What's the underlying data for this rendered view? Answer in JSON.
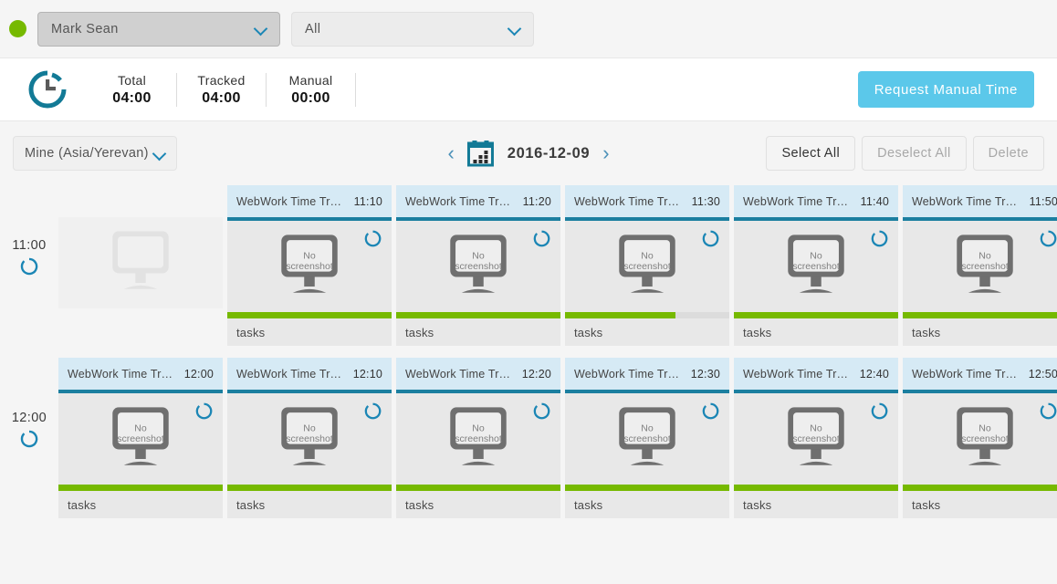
{
  "filterbar": {
    "status_dot_color": "#76b900",
    "user_select": {
      "value": "Mark  Sean",
      "icon": "chevron-down-icon"
    },
    "project_select": {
      "value": "All",
      "icon": "chevron-down-icon"
    }
  },
  "totals": {
    "icon": "clock-icon",
    "stats": [
      {
        "label": "Total",
        "value": "04:00"
      },
      {
        "label": "Tracked",
        "value": "04:00"
      },
      {
        "label": "Manual",
        "value": "00:00"
      }
    ],
    "request_button": {
      "label": "Request  Manual  Time",
      "color": "#5bc8ea"
    }
  },
  "toolbar": {
    "timezone": {
      "value": "Mine  (Asia/Yerevan)",
      "icon": "chevron-down-icon"
    },
    "date_nav": {
      "prev_icon": "chevron-left-icon",
      "calendar_icon": "calendar-icon",
      "date": "2016-12-09",
      "next_icon": "chevron-right-icon"
    },
    "buttons": [
      {
        "label": "Select  All",
        "state": "active"
      },
      {
        "label": "Deselect  All",
        "state": "disabled"
      },
      {
        "label": "Delete",
        "state": "disabled"
      }
    ]
  },
  "grid": {
    "placeholder_label": "No screenshot",
    "rows": [
      {
        "time": "11:00",
        "spinner_icon": "loading-ring-icon",
        "cells": [
          {
            "type": "empty"
          },
          {
            "type": "card",
            "title": "WebWork Time Tr…",
            "time": "11:10",
            "activity": 100,
            "tasks": "tasks",
            "thumb": "No screenshot",
            "spinner_icon": "loading-ring-icon"
          },
          {
            "type": "card",
            "title": "WebWork Time Tr…",
            "time": "11:20",
            "activity": 100,
            "tasks": "tasks",
            "thumb": "No screenshot",
            "spinner_icon": "loading-ring-icon"
          },
          {
            "type": "card",
            "title": "WebWork Time Tr…",
            "time": "11:30",
            "activity": 67,
            "tasks": "tasks",
            "thumb": "No screenshot",
            "spinner_icon": "loading-ring-icon"
          },
          {
            "type": "card",
            "title": "WebWork Time Tr…",
            "time": "11:40",
            "activity": 100,
            "tasks": "tasks",
            "thumb": "No screenshot",
            "spinner_icon": "loading-ring-icon"
          },
          {
            "type": "card",
            "title": "WebWork Time Tr…",
            "time": "11:50",
            "activity": 100,
            "tasks": "tasks",
            "thumb": "No screenshot",
            "spinner_icon": "loading-ring-icon"
          }
        ]
      },
      {
        "time": "12:00",
        "spinner_icon": "loading-ring-icon",
        "cells": [
          {
            "type": "card",
            "title": "WebWork Time Tr…",
            "time": "12:00",
            "activity": 100,
            "tasks": "tasks",
            "thumb": "No screenshot",
            "spinner_icon": "loading-ring-icon"
          },
          {
            "type": "card",
            "title": "WebWork Time Tr…",
            "time": "12:10",
            "activity": 100,
            "tasks": "tasks",
            "thumb": "No screenshot",
            "spinner_icon": "loading-ring-icon"
          },
          {
            "type": "card",
            "title": "WebWork Time Tr…",
            "time": "12:20",
            "activity": 100,
            "tasks": "tasks",
            "thumb": "No screenshot",
            "spinner_icon": "loading-ring-icon"
          },
          {
            "type": "card",
            "title": "WebWork Time Tr…",
            "time": "12:30",
            "activity": 100,
            "tasks": "tasks",
            "thumb": "No screenshot",
            "spinner_icon": "loading-ring-icon"
          },
          {
            "type": "card",
            "title": "WebWork Time Tr…",
            "time": "12:40",
            "activity": 100,
            "tasks": "tasks",
            "thumb": "No screenshot",
            "spinner_icon": "loading-ring-icon"
          },
          {
            "type": "card",
            "title": "WebWork Time Tr…",
            "time": "12:50",
            "activity": 100,
            "tasks": "tasks",
            "thumb": "No screenshot",
            "spinner_icon": "loading-ring-icon"
          }
        ]
      }
    ]
  }
}
